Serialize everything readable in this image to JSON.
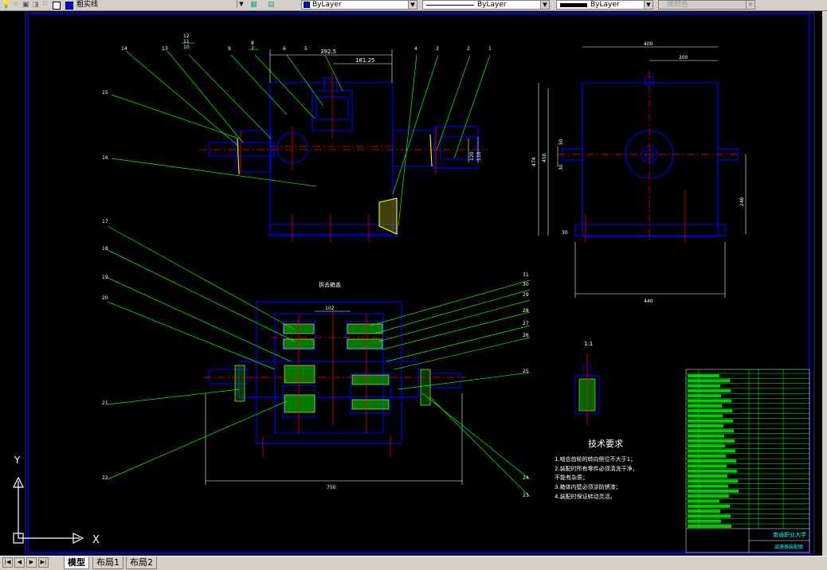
{
  "toolbar": {
    "layer_name": "粗实线",
    "color_label": "ByLayer",
    "linetype_label": "ByLayer",
    "lineweight_label": "ByLayer",
    "plotstyle_label": "随颜色"
  },
  "tabs": {
    "model": "模型",
    "layout1": "布局1",
    "layout2": "布局2"
  },
  "drawing": {
    "top_dims": [
      "392.5",
      "181.25",
      "120",
      "110"
    ],
    "top_balloons": [
      "14",
      "13",
      "12",
      "11",
      "10",
      "9",
      "8",
      "7",
      "6",
      "5",
      "4",
      "3",
      "2",
      "1"
    ],
    "left_balloons": [
      "15",
      "16"
    ],
    "side_dims": [
      "400",
      "200",
      "474",
      "450",
      "50",
      "30",
      "240",
      "440",
      "30"
    ],
    "section_title": "拆去箱盖",
    "section_dim": "102",
    "section_width": "750",
    "section_left_balloons": [
      "17",
      "18",
      "19",
      "20",
      "21",
      "22"
    ],
    "section_right_balloons": [
      "31",
      "30",
      "29",
      "28",
      "27",
      "26",
      "25",
      "24",
      "23"
    ],
    "detail_label": "1:1",
    "tech_title": "技术要求",
    "tech_lines": [
      "1.啮合齿轮的转向侧位不大于1；",
      "2.装配时所有零件必须清洗干净，",
      "  不能有杂质；",
      "3.箱体内壁必须涂防锈漆；",
      "4.装配时保证转动灵活。"
    ],
    "title_block_school": "南通职业大学",
    "title_block_name": "减速器装配图",
    "axis_y": "Y",
    "axis_x": "X"
  }
}
